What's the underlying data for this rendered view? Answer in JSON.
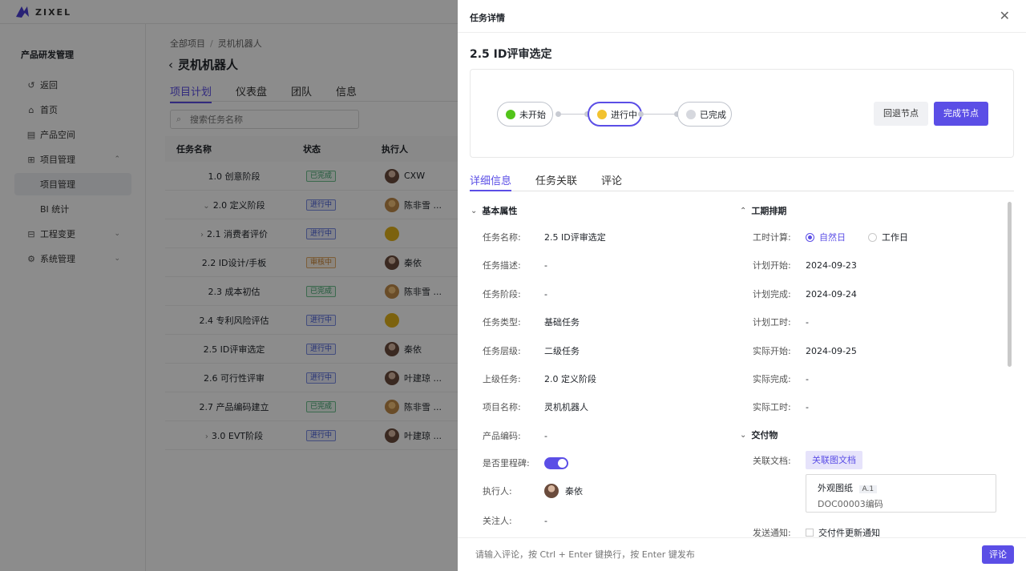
{
  "brand": {
    "name": "ZIXEL",
    "accent": "#5b4ee6"
  },
  "sidebar": {
    "title": "产品研发管理",
    "items": [
      {
        "label": "返回",
        "icon": "return-icon"
      },
      {
        "label": "首页",
        "icon": "home-icon"
      },
      {
        "label": "产品空间",
        "icon": "space-icon"
      },
      {
        "label": "项目管理",
        "icon": "grid-icon"
      },
      {
        "label": "项目管理"
      },
      {
        "label": "BI 统计"
      },
      {
        "label": "工程变更",
        "icon": "change-icon"
      },
      {
        "label": "系统管理",
        "icon": "settings-icon"
      }
    ]
  },
  "main": {
    "breadcrumb": [
      "全部项目",
      "灵机机器人"
    ],
    "title": "灵机机器人",
    "tabs": [
      "项目计划",
      "仪表盘",
      "团队",
      "信息"
    ],
    "search_placeholder": "搜索任务名称",
    "columns": [
      "任务名称",
      "状态",
      "执行人"
    ],
    "rows": [
      {
        "name": "1.0 创意阶段",
        "status": "已完成",
        "status_color": "green",
        "assignee": "CXW",
        "avatar": "a",
        "caret": ""
      },
      {
        "name": "2.0 定义阶段",
        "status": "进行中",
        "status_color": "blue",
        "assignee": "陈非雪 ...",
        "avatar": "b",
        "caret": "⌄"
      },
      {
        "name": "2.1 消费者评价",
        "status": "进行中",
        "status_color": "blue",
        "assignee": "",
        "avatar": "y",
        "caret": "›"
      },
      {
        "name": "2.2 ID设计/手板",
        "status": "审核中",
        "status_color": "orange",
        "assignee": "秦依",
        "avatar": "a",
        "caret": ""
      },
      {
        "name": "2.3 成本初估",
        "status": "已完成",
        "status_color": "green",
        "assignee": "陈非雪 ...",
        "avatar": "b",
        "caret": ""
      },
      {
        "name": "2.4 专利风险评估",
        "status": "进行中",
        "status_color": "blue",
        "assignee": "",
        "avatar": "y",
        "caret": ""
      },
      {
        "name": "2.5 ID评审选定",
        "status": "进行中",
        "status_color": "blue",
        "assignee": "秦依",
        "avatar": "a",
        "caret": ""
      },
      {
        "name": "2.6 可行性评审",
        "status": "进行中",
        "status_color": "blue",
        "assignee": "叶建琼 ...",
        "avatar": "a",
        "caret": ""
      },
      {
        "name": "2.7 产品编码建立",
        "status": "已完成",
        "status_color": "green",
        "assignee": "陈非雪 ...",
        "avatar": "b",
        "caret": ""
      },
      {
        "name": "3.0 EVT阶段",
        "status": "进行中",
        "status_color": "blue",
        "assignee": "叶建琼 ...",
        "avatar": "a",
        "caret": "›"
      }
    ]
  },
  "drawer": {
    "title": "任务详情",
    "task_title": "2.5 ID评审选定",
    "stages": [
      "未开始",
      "进行中",
      "已完成"
    ],
    "rollback_label": "回退节点",
    "complete_label": "完成节点",
    "tabs": [
      "详细信息",
      "任务关联",
      "评论"
    ],
    "basic": {
      "header": "基本属性",
      "fields": [
        {
          "label": "任务名称:",
          "value": "2.5 ID评审选定"
        },
        {
          "label": "任务描述:",
          "value": "-"
        },
        {
          "label": "任务阶段:",
          "value": "-"
        },
        {
          "label": "任务类型:",
          "value": "基础任务"
        },
        {
          "label": "任务层级:",
          "value": "二级任务"
        },
        {
          "label": "上级任务:",
          "value": "2.0 定义阶段"
        },
        {
          "label": "项目名称:",
          "value": "灵机机器人"
        },
        {
          "label": "产品编码:",
          "value": "-"
        }
      ],
      "milestone_label": "是否里程碑:",
      "milestone_on": true,
      "assignee_label": "执行人:",
      "assignee_value": "秦依",
      "follower_label": "关注人:",
      "follower_value": "-"
    },
    "schedule": {
      "header": "工期排期",
      "calc_label": "工时计算:",
      "calc_options": [
        "自然日",
        "工作日"
      ],
      "calc_selected": "自然日",
      "fields": [
        {
          "label": "计划开始:",
          "value": "2024-09-23"
        },
        {
          "label": "计划完成:",
          "value": "2024-09-24"
        },
        {
          "label": "计划工时:",
          "value": "-"
        },
        {
          "label": "实际开始:",
          "value": "2024-09-25"
        },
        {
          "label": "实际完成:",
          "value": "-"
        },
        {
          "label": "实际工时:",
          "value": "-"
        }
      ]
    },
    "deliverables": {
      "header": "交付物",
      "doc_label": "关联文档:",
      "link_button": "关联图文档",
      "doc_name": "外观图纸",
      "doc_version": "A.1",
      "doc_code": "DOC00003编码",
      "notify_label": "发送通知:",
      "notify_option": "交付件更新通知"
    },
    "comment_placeholder": "请输入评论，按 Ctrl + Enter 键换行，按 Enter 键发布",
    "comment_button": "评论"
  }
}
